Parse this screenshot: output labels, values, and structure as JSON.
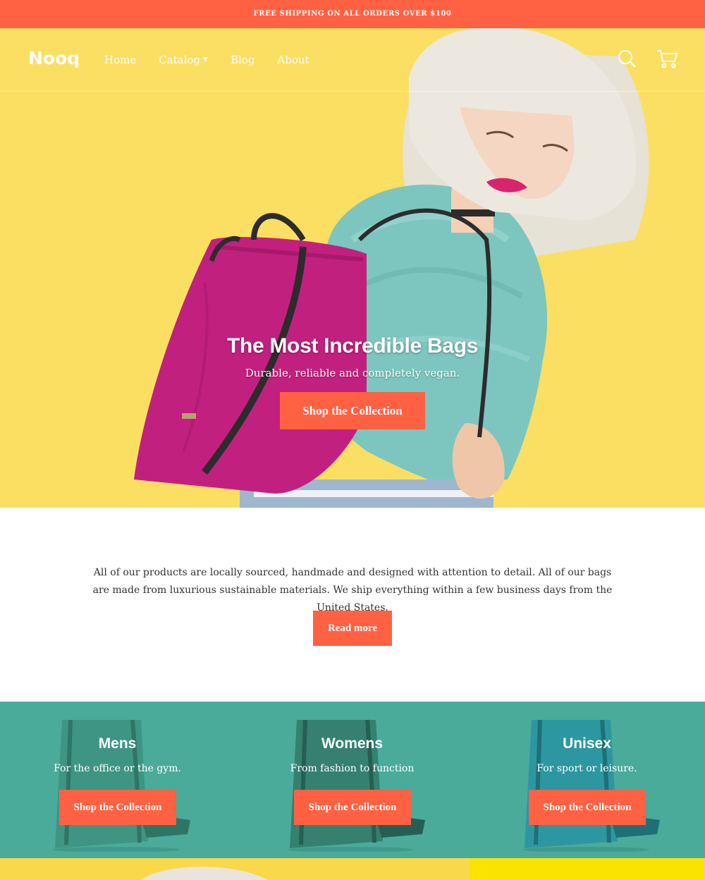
{
  "announcement": "FREE SHIPPING ON ALL ORDERS OVER $100",
  "header": {
    "logo": "Nooq",
    "nav": [
      {
        "label": "Home"
      },
      {
        "label": "Catalog",
        "has_dropdown": true
      },
      {
        "label": "Blog"
      },
      {
        "label": "About"
      }
    ],
    "icons": [
      "search-icon",
      "cart-icon"
    ]
  },
  "hero": {
    "title": "The Most Incredible Bags",
    "subtitle": "Durable, reliable and completely vegan.",
    "button": "Shop the Collection"
  },
  "about": {
    "text": "All of our products are locally sourced, handmade and designed with attention to detail. All of our bags are made from luxurious sustainable materials. We ship everything within a few business days from the United States.",
    "button": "Read more"
  },
  "collections": [
    {
      "title": "Mens",
      "subtitle": "For the office or the gym.",
      "button": "Shop the Collection"
    },
    {
      "title": "Womens",
      "subtitle": "From fashion to function",
      "button": "Shop the Collection"
    },
    {
      "title": "Unisex",
      "subtitle": "For sport or leisure.",
      "button": "Shop the Collection"
    }
  ],
  "colors": {
    "accent": "#ff6142",
    "hero_bg": "#fbdf62",
    "collections_bg": "#4aab9b",
    "text": "#333333"
  }
}
